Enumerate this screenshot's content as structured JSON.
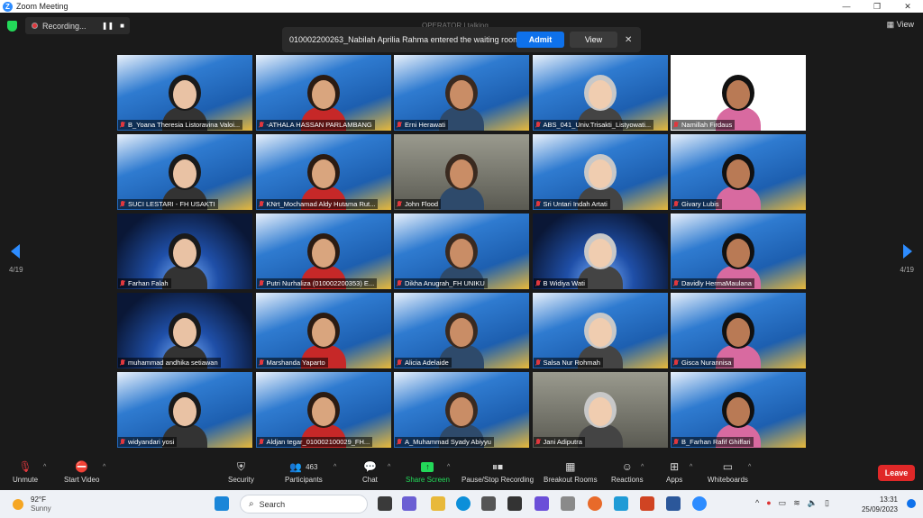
{
  "window": {
    "title": "Zoom Meeting",
    "view_label": "View",
    "min": "—",
    "max": "❐",
    "close": "✕"
  },
  "meeting": {
    "recording_label": "Recording...",
    "operator_text": "OPERATOR  | talking...",
    "page_indicator_left": "4/19",
    "page_indicator_right": "4/19"
  },
  "notification": {
    "message": "010002200263_Nabilah Aprilia Rahma entered the waiting room",
    "admit_label": "Admit",
    "view_label": "View",
    "close": "✕"
  },
  "participants": [
    {
      "name": "B_Yoana Theresia Listoravina Valoi...",
      "kind": "banner"
    },
    {
      "name": "-ATHALA HASSAN PARLAMBANG",
      "kind": "banner"
    },
    {
      "name": "Erni Herawati",
      "kind": "banner"
    },
    {
      "name": "ABS_041_Univ.Trisakti_Listyowati...",
      "kind": "banner"
    },
    {
      "name": "Namillah Firdaus",
      "kind": "white"
    },
    {
      "name": "SUCI LESTARI - FH USAKTI",
      "kind": "banner"
    },
    {
      "name": "KNrt_Mochamad Aldy Hutama Rut...",
      "kind": "banner"
    },
    {
      "name": "John Flood",
      "kind": "room"
    },
    {
      "name": "Sri Untari Indah Artati",
      "kind": "banner"
    },
    {
      "name": "Givary Lubis",
      "kind": "banner"
    },
    {
      "name": "Farhan Falah",
      "kind": "space"
    },
    {
      "name": "Putri Nurhaliza (010002200353) E...",
      "kind": "banner"
    },
    {
      "name": "Dikha Anugrah_FH UNIKU",
      "kind": "banner"
    },
    {
      "name": "B Widiya Wati",
      "kind": "space"
    },
    {
      "name": "Davidly HermaMaulana",
      "kind": "banner"
    },
    {
      "name": "muhammad andhika setiawan",
      "kind": "space"
    },
    {
      "name": "Marshanda Yaparto",
      "kind": "banner"
    },
    {
      "name": "Alicia Adelaide",
      "kind": "banner"
    },
    {
      "name": "Salsa Nur Rohmah",
      "kind": "banner"
    },
    {
      "name": "Gisca Nurannisa",
      "kind": "banner"
    },
    {
      "name": "widyandari yosi",
      "kind": "banner"
    },
    {
      "name": "Aldjan tegar_010002100029_FH...",
      "kind": "banner"
    },
    {
      "name": "A_Muhammad Syady Abiyyu",
      "kind": "banner"
    },
    {
      "name": "Jani Adiputra",
      "kind": "room"
    },
    {
      "name": "B_Farhan Rafif Ghiffari",
      "kind": "banner"
    }
  ],
  "toolbar": {
    "unmute": "Unmute",
    "start_video": "Start Video",
    "security": "Security",
    "participants": "Participants",
    "participants_count": "463",
    "chat": "Chat",
    "share_screen": "Share Screen",
    "recording": "Pause/Stop Recording",
    "breakout": "Breakout Rooms",
    "reactions": "Reactions",
    "apps": "Apps",
    "whiteboards": "Whiteboards",
    "leave": "Leave"
  },
  "taskbar": {
    "temperature": "92°F",
    "weather": "Sunny",
    "search_placeholder": "Search",
    "time": "13:31",
    "date": "25/09/2023"
  },
  "colors": {
    "accent": "#0e71eb",
    "leave": "#e02828",
    "share": "#23d959",
    "banner": "#1d5fb0"
  }
}
